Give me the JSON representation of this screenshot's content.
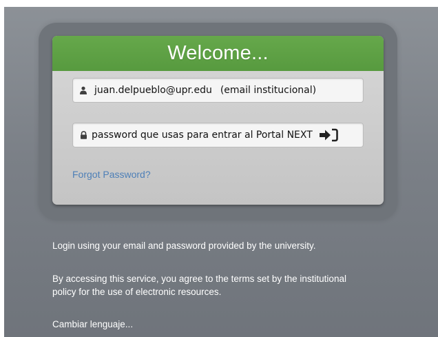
{
  "login_card": {
    "title": "Welcome...",
    "username": {
      "value": "juan.delpueblo@upr.edu",
      "hint": "(email institucional)",
      "icon": "user-icon"
    },
    "password": {
      "value": "password que usas para entrar al Portal NEXT",
      "icon": "lock-icon",
      "submit_icon": "sign-in-icon"
    },
    "forgot_password": "Forgot Password?"
  },
  "footer": {
    "info_1": "Login using your email and password provided by the university.",
    "info_2": "By accessing this service, you agree to the terms set by the institutional policy for the use of electronic resources.",
    "language_link": "Cambiar lenguaje..."
  },
  "colors": {
    "header_green": "#5aa042",
    "link_blue": "#4d7fb7",
    "background_gray": "#7b8087"
  }
}
